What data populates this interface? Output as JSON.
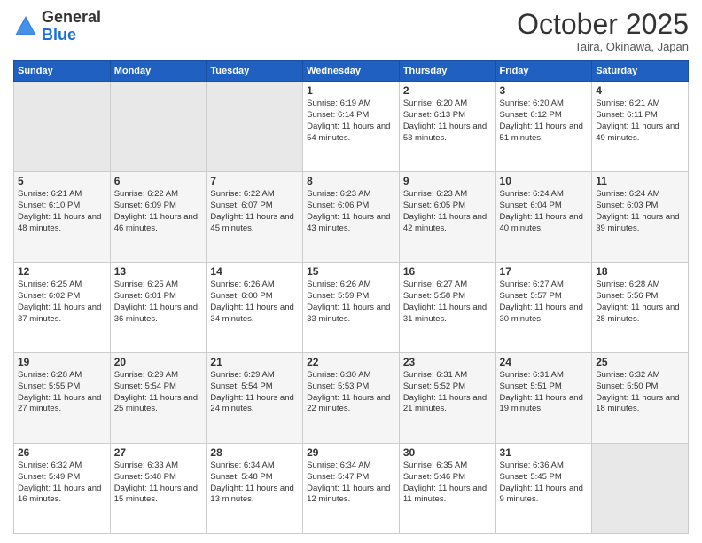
{
  "header": {
    "logo_general": "General",
    "logo_blue": "Blue",
    "month": "October 2025",
    "location": "Taira, Okinawa, Japan"
  },
  "days_of_week": [
    "Sunday",
    "Monday",
    "Tuesday",
    "Wednesday",
    "Thursday",
    "Friday",
    "Saturday"
  ],
  "weeks": [
    [
      {
        "day": "",
        "info": ""
      },
      {
        "day": "",
        "info": ""
      },
      {
        "day": "",
        "info": ""
      },
      {
        "day": "1",
        "info": "Sunrise: 6:19 AM\nSunset: 6:14 PM\nDaylight: 11 hours\nand 54 minutes."
      },
      {
        "day": "2",
        "info": "Sunrise: 6:20 AM\nSunset: 6:13 PM\nDaylight: 11 hours\nand 53 minutes."
      },
      {
        "day": "3",
        "info": "Sunrise: 6:20 AM\nSunset: 6:12 PM\nDaylight: 11 hours\nand 51 minutes."
      },
      {
        "day": "4",
        "info": "Sunrise: 6:21 AM\nSunset: 6:11 PM\nDaylight: 11 hours\nand 49 minutes."
      }
    ],
    [
      {
        "day": "5",
        "info": "Sunrise: 6:21 AM\nSunset: 6:10 PM\nDaylight: 11 hours\nand 48 minutes."
      },
      {
        "day": "6",
        "info": "Sunrise: 6:22 AM\nSunset: 6:09 PM\nDaylight: 11 hours\nand 46 minutes."
      },
      {
        "day": "7",
        "info": "Sunrise: 6:22 AM\nSunset: 6:07 PM\nDaylight: 11 hours\nand 45 minutes."
      },
      {
        "day": "8",
        "info": "Sunrise: 6:23 AM\nSunset: 6:06 PM\nDaylight: 11 hours\nand 43 minutes."
      },
      {
        "day": "9",
        "info": "Sunrise: 6:23 AM\nSunset: 6:05 PM\nDaylight: 11 hours\nand 42 minutes."
      },
      {
        "day": "10",
        "info": "Sunrise: 6:24 AM\nSunset: 6:04 PM\nDaylight: 11 hours\nand 40 minutes."
      },
      {
        "day": "11",
        "info": "Sunrise: 6:24 AM\nSunset: 6:03 PM\nDaylight: 11 hours\nand 39 minutes."
      }
    ],
    [
      {
        "day": "12",
        "info": "Sunrise: 6:25 AM\nSunset: 6:02 PM\nDaylight: 11 hours\nand 37 minutes."
      },
      {
        "day": "13",
        "info": "Sunrise: 6:25 AM\nSunset: 6:01 PM\nDaylight: 11 hours\nand 36 minutes."
      },
      {
        "day": "14",
        "info": "Sunrise: 6:26 AM\nSunset: 6:00 PM\nDaylight: 11 hours\nand 34 minutes."
      },
      {
        "day": "15",
        "info": "Sunrise: 6:26 AM\nSunset: 5:59 PM\nDaylight: 11 hours\nand 33 minutes."
      },
      {
        "day": "16",
        "info": "Sunrise: 6:27 AM\nSunset: 5:58 PM\nDaylight: 11 hours\nand 31 minutes."
      },
      {
        "day": "17",
        "info": "Sunrise: 6:27 AM\nSunset: 5:57 PM\nDaylight: 11 hours\nand 30 minutes."
      },
      {
        "day": "18",
        "info": "Sunrise: 6:28 AM\nSunset: 5:56 PM\nDaylight: 11 hours\nand 28 minutes."
      }
    ],
    [
      {
        "day": "19",
        "info": "Sunrise: 6:28 AM\nSunset: 5:55 PM\nDaylight: 11 hours\nand 27 minutes."
      },
      {
        "day": "20",
        "info": "Sunrise: 6:29 AM\nSunset: 5:54 PM\nDaylight: 11 hours\nand 25 minutes."
      },
      {
        "day": "21",
        "info": "Sunrise: 6:29 AM\nSunset: 5:54 PM\nDaylight: 11 hours\nand 24 minutes."
      },
      {
        "day": "22",
        "info": "Sunrise: 6:30 AM\nSunset: 5:53 PM\nDaylight: 11 hours\nand 22 minutes."
      },
      {
        "day": "23",
        "info": "Sunrise: 6:31 AM\nSunset: 5:52 PM\nDaylight: 11 hours\nand 21 minutes."
      },
      {
        "day": "24",
        "info": "Sunrise: 6:31 AM\nSunset: 5:51 PM\nDaylight: 11 hours\nand 19 minutes."
      },
      {
        "day": "25",
        "info": "Sunrise: 6:32 AM\nSunset: 5:50 PM\nDaylight: 11 hours\nand 18 minutes."
      }
    ],
    [
      {
        "day": "26",
        "info": "Sunrise: 6:32 AM\nSunset: 5:49 PM\nDaylight: 11 hours\nand 16 minutes."
      },
      {
        "day": "27",
        "info": "Sunrise: 6:33 AM\nSunset: 5:48 PM\nDaylight: 11 hours\nand 15 minutes."
      },
      {
        "day": "28",
        "info": "Sunrise: 6:34 AM\nSunset: 5:48 PM\nDaylight: 11 hours\nand 13 minutes."
      },
      {
        "day": "29",
        "info": "Sunrise: 6:34 AM\nSunset: 5:47 PM\nDaylight: 11 hours\nand 12 minutes."
      },
      {
        "day": "30",
        "info": "Sunrise: 6:35 AM\nSunset: 5:46 PM\nDaylight: 11 hours\nand 11 minutes."
      },
      {
        "day": "31",
        "info": "Sunrise: 6:36 AM\nSunset: 5:45 PM\nDaylight: 11 hours\nand 9 minutes."
      },
      {
        "day": "",
        "info": ""
      }
    ]
  ]
}
